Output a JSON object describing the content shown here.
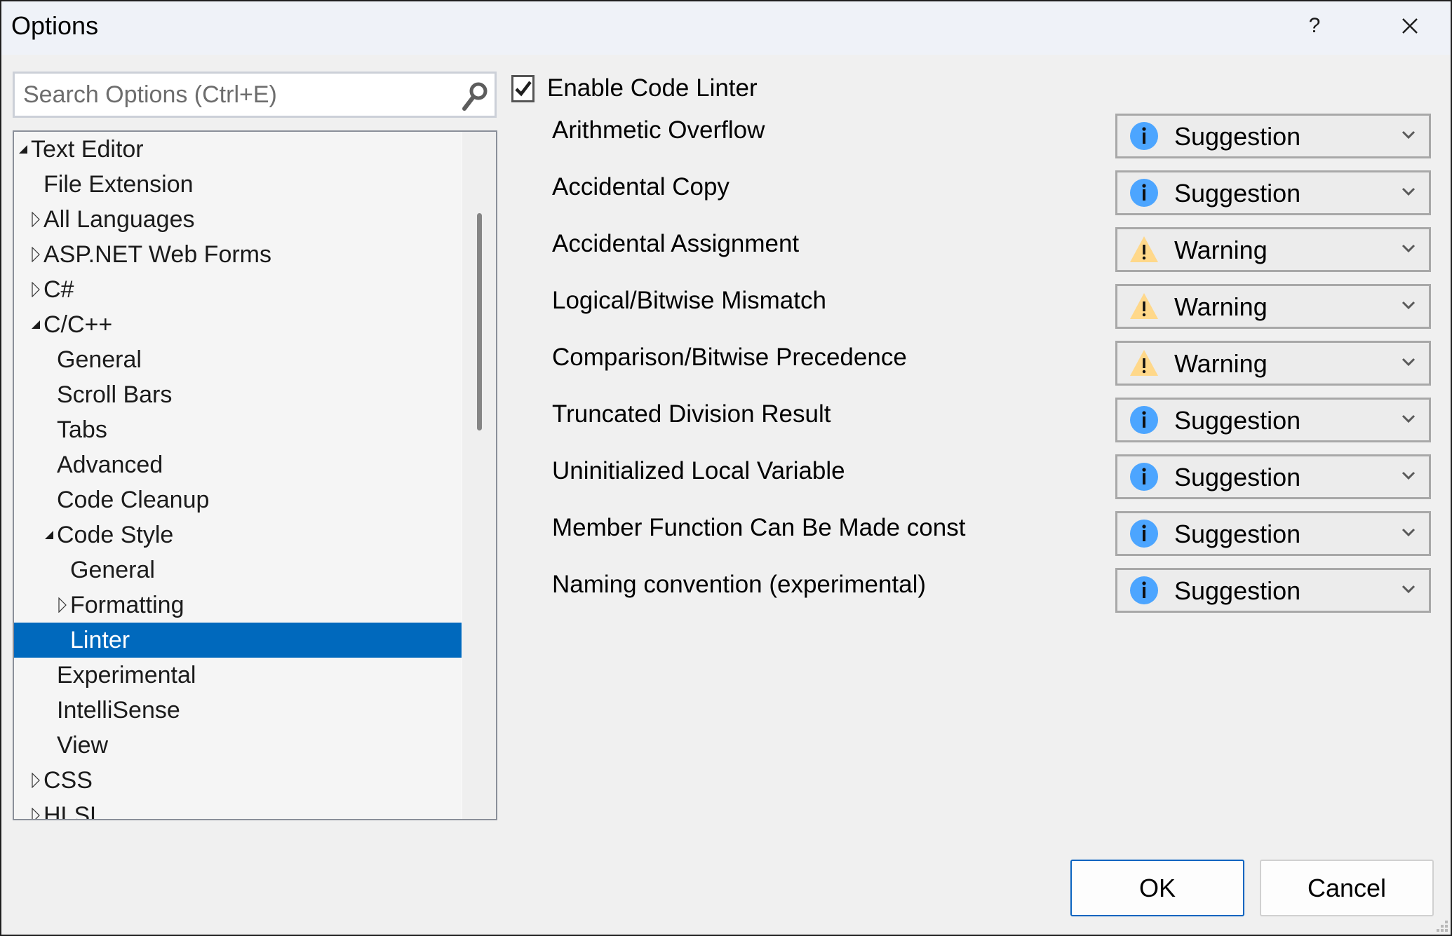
{
  "window": {
    "title": "Options",
    "help_label": "?",
    "close_label": "✕"
  },
  "search": {
    "placeholder": "Search Options (Ctrl+E)",
    "value": ""
  },
  "tree": {
    "items": [
      {
        "label": "Text Editor",
        "level": 0,
        "expander": "expanded"
      },
      {
        "label": "File Extension",
        "level": 1,
        "expander": "none"
      },
      {
        "label": "All Languages",
        "level": 1,
        "expander": "collapsed"
      },
      {
        "label": "ASP.NET Web Forms",
        "level": 1,
        "expander": "collapsed"
      },
      {
        "label": "C#",
        "level": 1,
        "expander": "collapsed"
      },
      {
        "label": "C/C++",
        "level": 1,
        "expander": "expanded"
      },
      {
        "label": "General",
        "level": 2,
        "expander": "none"
      },
      {
        "label": "Scroll Bars",
        "level": 2,
        "expander": "none"
      },
      {
        "label": "Tabs",
        "level": 2,
        "expander": "none"
      },
      {
        "label": "Advanced",
        "level": 2,
        "expander": "none"
      },
      {
        "label": "Code Cleanup",
        "level": 2,
        "expander": "none"
      },
      {
        "label": "Code Style",
        "level": 2,
        "expander": "expanded"
      },
      {
        "label": "General",
        "level": 3,
        "expander": "none"
      },
      {
        "label": "Formatting",
        "level": 3,
        "expander": "collapsed"
      },
      {
        "label": "Linter",
        "level": 3,
        "expander": "none",
        "selected": true
      },
      {
        "label": "Experimental",
        "level": 2,
        "expander": "none"
      },
      {
        "label": "IntelliSense",
        "level": 2,
        "expander": "none"
      },
      {
        "label": "View",
        "level": 2,
        "expander": "none"
      },
      {
        "label": "CSS",
        "level": 1,
        "expander": "collapsed"
      },
      {
        "label": "HLSL",
        "level": 1,
        "expander": "collapsed"
      }
    ]
  },
  "linter": {
    "enable_label": "Enable Code Linter",
    "enabled": true,
    "rules": [
      {
        "label": "Arithmetic Overflow",
        "severity": "Suggestion",
        "icon": "info-icon"
      },
      {
        "label": "Accidental Copy",
        "severity": "Suggestion",
        "icon": "info-icon"
      },
      {
        "label": "Accidental Assignment",
        "severity": "Warning",
        "icon": "warning-icon"
      },
      {
        "label": "Logical/Bitwise Mismatch",
        "severity": "Warning",
        "icon": "warning-icon"
      },
      {
        "label": "Comparison/Bitwise Precedence",
        "severity": "Warning",
        "icon": "warning-icon"
      },
      {
        "label": "Truncated Division Result",
        "severity": "Suggestion",
        "icon": "info-icon"
      },
      {
        "label": "Uninitialized Local Variable",
        "severity": "Suggestion",
        "icon": "info-icon"
      },
      {
        "label": "Member Function Can Be Made const",
        "severity": "Suggestion",
        "icon": "info-icon"
      },
      {
        "label": "Naming convention (experimental)",
        "severity": "Suggestion",
        "icon": "info-icon"
      }
    ]
  },
  "footer": {
    "ok_label": "OK",
    "cancel_label": "Cancel"
  },
  "colors": {
    "selection": "#0069bd",
    "info": "#4ca5ff",
    "warning": "#ffd88a",
    "ok_border": "#0b64c0"
  }
}
